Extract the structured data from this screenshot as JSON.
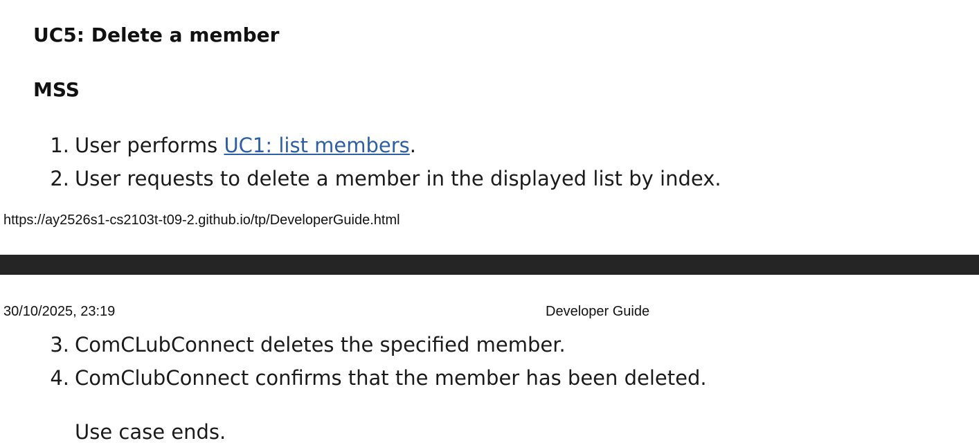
{
  "section": {
    "title": "UC5: Delete a member",
    "subtitle": "MSS"
  },
  "steps": [
    {
      "number": "1.",
      "text_before": "User performs ",
      "link_text": "UC1: list members",
      "text_after": "."
    },
    {
      "number": "2.",
      "text": "User requests to delete a member in the displayed list by index."
    },
    {
      "number": "3.",
      "text": "ComCLubConnect deletes the specified member."
    },
    {
      "number": "4.",
      "text": "ComClubConnect confirms that the member has been deleted."
    }
  ],
  "conclusion": "Use case ends.",
  "print": {
    "url": "https://ay2526s1-cs2103t-t09-2.github.io/tp/DeveloperGuide.html",
    "datetime": "30/10/2025, 23:19",
    "doc_title": "Developer Guide"
  },
  "colors": {
    "link": "#2d5fa6",
    "page_break": "#252525"
  }
}
